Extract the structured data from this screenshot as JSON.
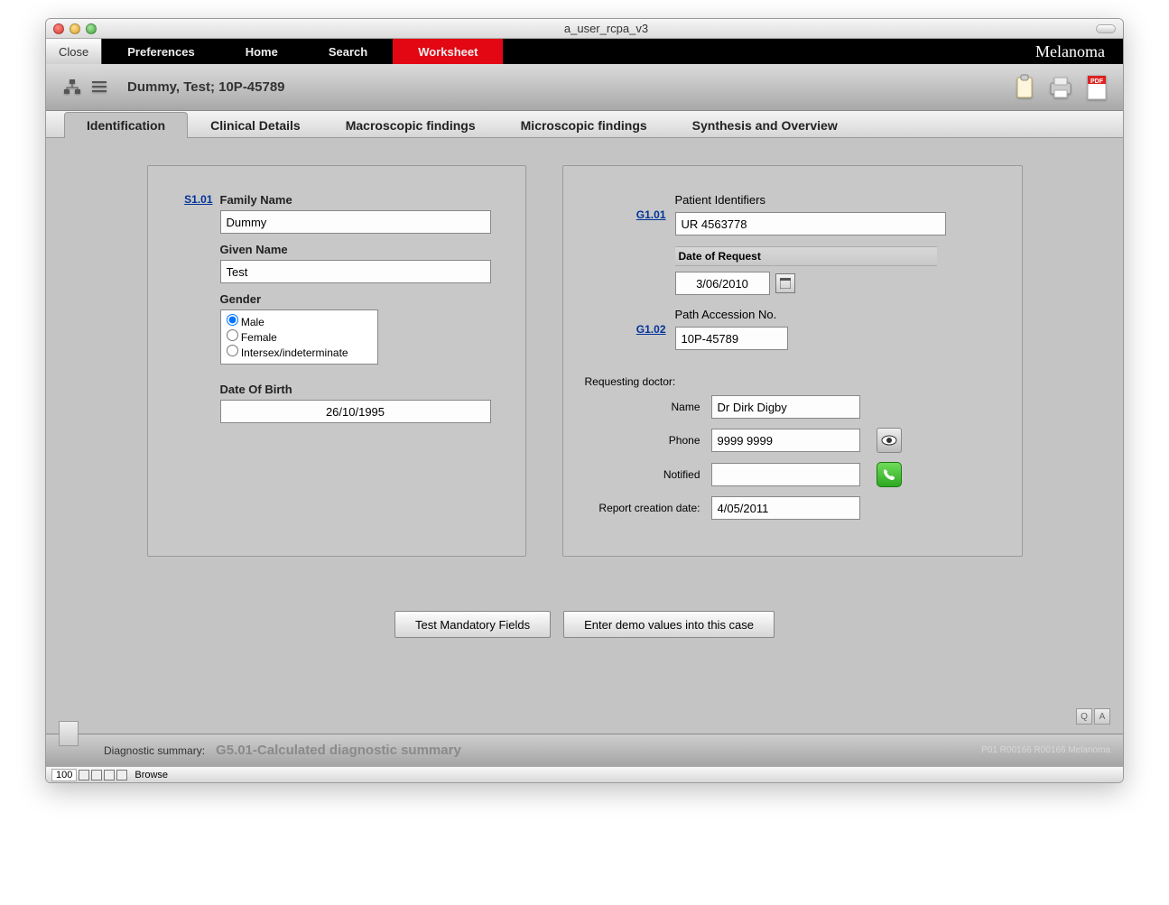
{
  "window": {
    "title": "a_user_rcpa_v3"
  },
  "menubar": {
    "close": "Close",
    "items": [
      "Preferences",
      "Home",
      "Search",
      "Worksheet"
    ],
    "active_index": 3,
    "brand": "Melanoma"
  },
  "toolbar": {
    "patient": "Dummy, Test; 10P-45789"
  },
  "tabs": {
    "items": [
      "Identification",
      "Clinical Details",
      "Macroscopic findings",
      "Microscopic findings",
      "Synthesis and Overview"
    ],
    "active_index": 0
  },
  "left": {
    "s101": "S1.01",
    "family_name": {
      "label": "Family Name",
      "value": "Dummy"
    },
    "given_name": {
      "label": "Given Name",
      "value": "Test"
    },
    "gender": {
      "label": "Gender",
      "options": [
        "Male",
        "Female",
        "Intersex/indeterminate"
      ],
      "selected": "Male"
    },
    "dob": {
      "label": "Date Of Birth",
      "value": "26/10/1995"
    }
  },
  "right": {
    "g101": "G1.01",
    "patient_identifiers": {
      "label": "Patient Identifiers",
      "value": "UR 4563778"
    },
    "date_of_request": {
      "label": "Date of Request",
      "value": "3/06/2010"
    },
    "g102": "G1.02",
    "path_accession": {
      "label": "Path Accession No.",
      "value": "10P-45789"
    },
    "requesting_doctor_label": "Requesting doctor:",
    "doctor_name": {
      "label": "Name",
      "value": "Dr Dirk Digby"
    },
    "doctor_phone": {
      "label": "Phone",
      "value": "9999 9999"
    },
    "notified": {
      "label": "Notified",
      "value": ""
    },
    "report_creation": {
      "label": "Report creation date:",
      "value": "4/05/2011"
    }
  },
  "actions": {
    "test_mandatory": "Test Mandatory Fields",
    "enter_demo": "Enter demo values into this case"
  },
  "qa": {
    "q": "Q",
    "a": "A"
  },
  "footer": {
    "diag_label": "Diagnostic summary:",
    "diag_value": "G5.01-Calculated diagnostic summary",
    "meta": "P01   R00166  R00166  Melanoma",
    "zoom": "100",
    "mode": "Browse"
  }
}
